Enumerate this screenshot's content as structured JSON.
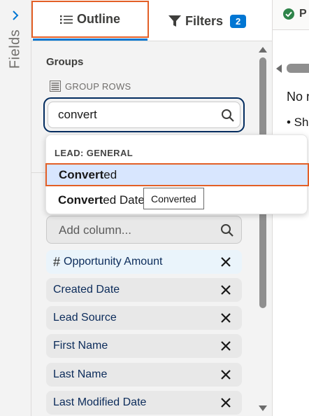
{
  "fields_rail": {
    "label": "Fields",
    "chevron_icon": "chevron-right-icon"
  },
  "tabs": {
    "outline": {
      "label": "Outline",
      "icon": "list-icon"
    },
    "filters": {
      "label": "Filters",
      "icon": "funnel-icon",
      "count": "2"
    }
  },
  "groups": {
    "heading": "Groups",
    "group_rows_label": "GROUP ROWS",
    "search": {
      "value": "convert"
    }
  },
  "dropdown": {
    "header": "LEAD: GENERAL",
    "items": [
      {
        "match": "Convert",
        "rest": "ed",
        "selected": true
      },
      {
        "match": "Convert",
        "rest": "ed Date",
        "selected": false
      }
    ],
    "tooltip": "Converted"
  },
  "columns": {
    "add_placeholder": "Add column...",
    "items": [
      {
        "label": "Opportunity Amount",
        "numeric": true
      },
      {
        "label": "Created Date"
      },
      {
        "label": "Lead Source"
      },
      {
        "label": "First Name"
      },
      {
        "label": "Last Name"
      },
      {
        "label": "Last Modified Date"
      }
    ]
  },
  "preview": {
    "top_label": "P",
    "line1": "No r",
    "line2": "• Sh"
  },
  "colors": {
    "accent_blue": "#0176d3",
    "highlight_orange": "#e35f26",
    "focus_navy": "#032d60",
    "selected_bg": "#d8e6fe",
    "success_green": "#2e844a"
  }
}
